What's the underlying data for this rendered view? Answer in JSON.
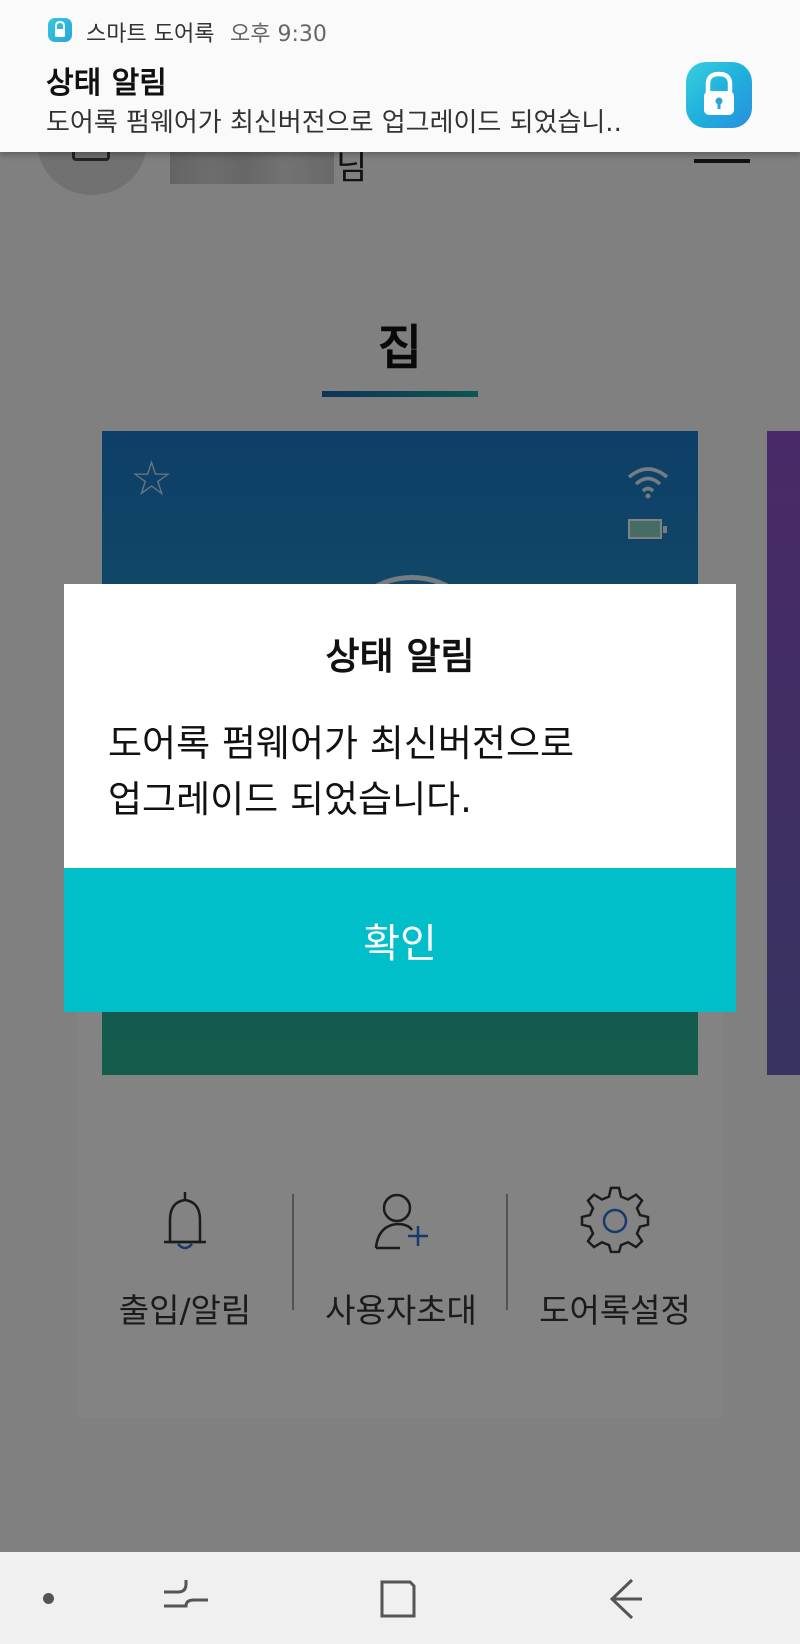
{
  "app_header": {
    "name_suffix": "님"
  },
  "tab": {
    "title": "집"
  },
  "actions": [
    {
      "label": "출입/알림",
      "icon": "bell-icon"
    },
    {
      "label": "사용자초대",
      "icon": "add-user-icon"
    },
    {
      "label": "도어록설정",
      "icon": "gear-icon"
    }
  ],
  "notification": {
    "app_name": "스마트 도어록",
    "time": "오후 9:30",
    "title": "상태 알림",
    "body": "도어록 펌웨어가 최신버전으로 업그레이드 되었습니..",
    "icon": "lock-icon"
  },
  "dialog": {
    "title": "상태 알림",
    "message_line1": "도어록 펌웨어가 최신버전으로",
    "message_line2": "업그레이드 되었습니다.",
    "confirm_label": "확인"
  },
  "navbar": {
    "items": [
      "recent-apps-icon",
      "home-icon",
      "back-icon"
    ]
  },
  "colors": {
    "accent": "#00bfc8",
    "card_top": "#1b77c6",
    "card_bottom": "#27b08d",
    "side_card": "#8b4fc4"
  }
}
